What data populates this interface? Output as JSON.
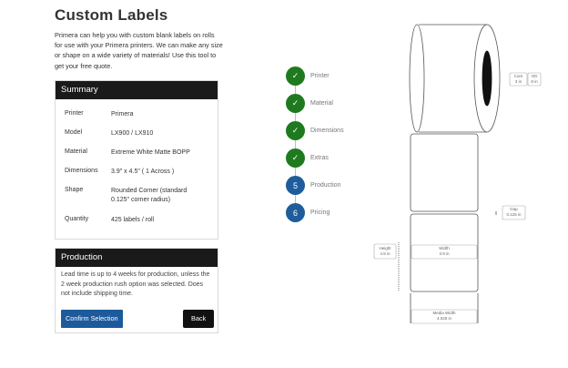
{
  "page": {
    "title": "Custom Labels",
    "intro": "Primera can help you with custom blank labels on rolls for use with your Primera printers. We can make any size or shape on a wide variety of materials! Use this tool to get your free quote."
  },
  "summary": {
    "heading": "Summary",
    "rows": [
      {
        "label": "Printer",
        "value": "Primera"
      },
      {
        "label": "Model",
        "value": "LX900 / LX910"
      },
      {
        "label": "Material",
        "value": "Extreme White Matte BOPP"
      },
      {
        "label": "Dimensions",
        "value": "3.9\" x 4.5\" ( 1 Across )"
      },
      {
        "label": "Shape",
        "value": "Rounded Corner (standard 0.125\" corner radius)"
      },
      {
        "label": "Quantity",
        "value": "425 labels / roll"
      }
    ]
  },
  "production": {
    "heading": "Production",
    "text": "Lead time is up to 4 weeks for production, unless the 2 week production rush option was selected. Does not include shipping time.",
    "confirm_label": "Confirm Selection",
    "back_label": "Back"
  },
  "steps": [
    {
      "label": "Printer",
      "status": "done",
      "marker": "✓"
    },
    {
      "label": "Material",
      "status": "done",
      "marker": "✓"
    },
    {
      "label": "Dimensions",
      "status": "done",
      "marker": "✓"
    },
    {
      "label": "Extras",
      "status": "done",
      "marker": "✓"
    },
    {
      "label": "Production",
      "status": "current",
      "marker": "5"
    },
    {
      "label": "Pricing",
      "status": "current",
      "marker": "6"
    }
  ],
  "diagram": {
    "core": {
      "label": "Core",
      "value": "3 in"
    },
    "od": {
      "label": "OD",
      "value": "8 in"
    },
    "gap": {
      "label": "Gap",
      "value": "0.125 in"
    },
    "height": {
      "label": "Height",
      "value": "4.5 in"
    },
    "width": {
      "label": "Width",
      "value": "3.9 in"
    },
    "media_width": {
      "label": "Media Width",
      "value": "4.025 in"
    }
  },
  "colors": {
    "header_bg": "#1a1a1a",
    "done_step": "#1f7a1f",
    "current_step": "#1e5c9c",
    "confirm_button": "#1c5a9b"
  }
}
